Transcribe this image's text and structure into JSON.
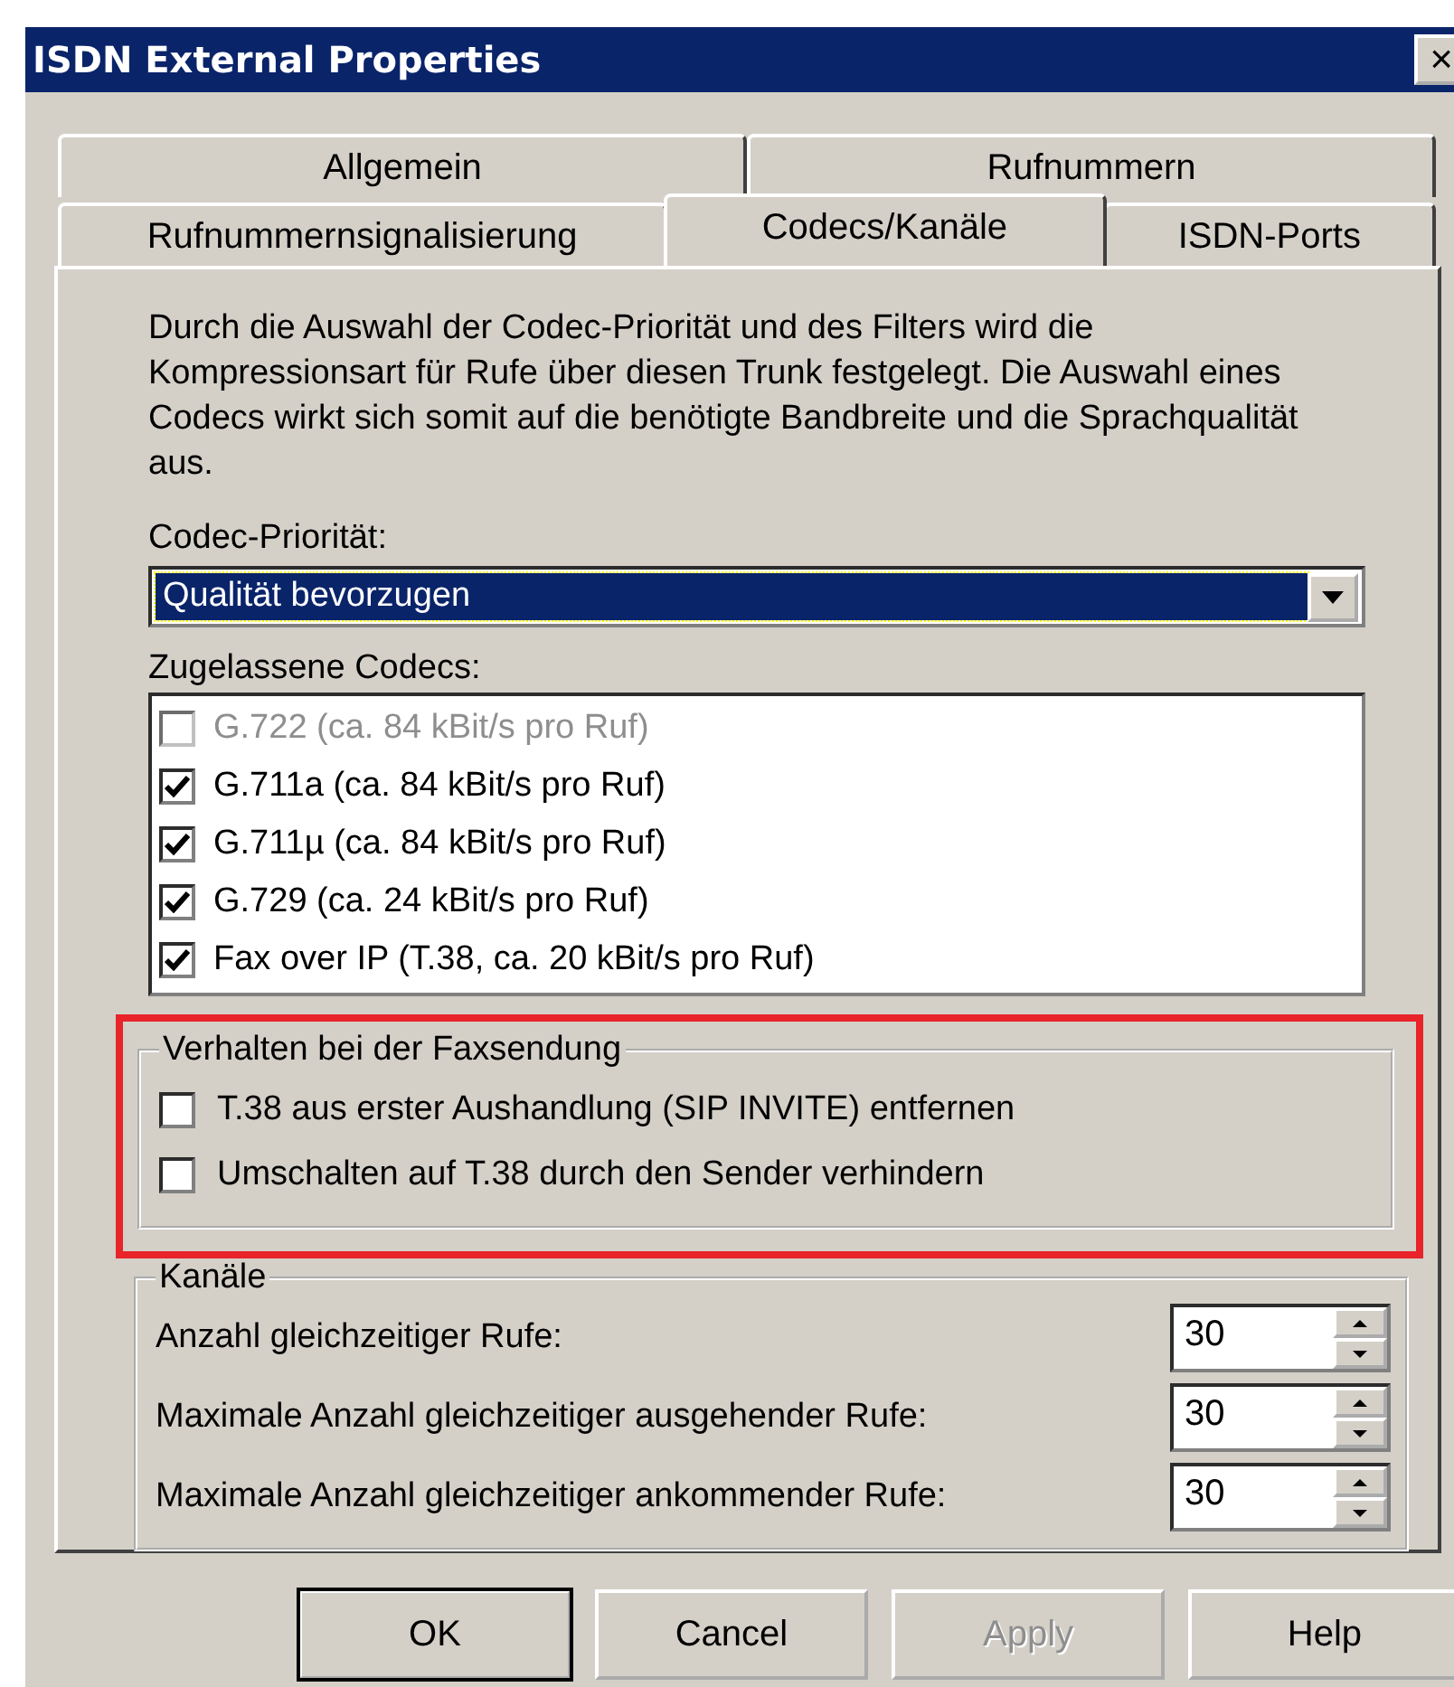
{
  "window": {
    "title": "ISDN External Properties",
    "close": "×"
  },
  "tabs": [
    [
      {
        "label": "Allgemein",
        "selected": false
      },
      {
        "label": "Rufnummern",
        "selected": false
      }
    ],
    [
      {
        "label": "Rufnummernsignalisierung",
        "selected": false
      },
      {
        "label": "Codecs/Kanäle",
        "selected": true
      },
      {
        "label": "ISDN-Ports",
        "selected": false
      }
    ]
  ],
  "description": "Durch die Auswahl der Codec-Priorität und des Filters wird die Kompressionsart für Rufe über diesen Trunk festgelegt. Die Auswahl eines Codecs wirkt sich somit auf die benötigte Bandbreite und die Sprachqualität aus.",
  "codec_priority": {
    "label": "Codec-Priorität:",
    "value": "Qualität bevorzugen"
  },
  "codecs": {
    "label": "Zugelassene Codecs:",
    "items": [
      {
        "label": "G.722 (ca. 84 kBit/s pro Ruf)",
        "checked": false,
        "disabled": true
      },
      {
        "label": "G.711a (ca. 84 kBit/s pro Ruf)",
        "checked": true,
        "disabled": false
      },
      {
        "label": "G.711µ (ca. 84 kBit/s pro Ruf)",
        "checked": true,
        "disabled": false
      },
      {
        "label": "G.729 (ca. 24 kBit/s pro Ruf)",
        "checked": true,
        "disabled": false
      },
      {
        "label": "Fax over IP (T.38, ca. 20 kBit/s pro Ruf)",
        "checked": true,
        "disabled": false
      }
    ]
  },
  "fax": {
    "title": "Verhalten bei der Faxsendung",
    "highlighted": true,
    "options": [
      {
        "label": "T.38 aus erster Aushandlung (SIP INVITE) entfernen",
        "checked": false
      },
      {
        "label": "Umschalten auf T.38 durch den Sender verhindern",
        "checked": false
      }
    ]
  },
  "channels": {
    "title": "Kanäle",
    "rows": [
      {
        "label": "Anzahl gleichzeitiger Rufe:",
        "value": "30"
      },
      {
        "label": "Maximale Anzahl gleichzeitiger ausgehender Rufe:",
        "value": "30"
      },
      {
        "label": "Maximale Anzahl gleichzeitiger ankommender Rufe:",
        "value": "30"
      }
    ]
  },
  "buttons": [
    {
      "label": "OK",
      "default": true,
      "disabled": false
    },
    {
      "label": "Cancel",
      "default": false,
      "disabled": false
    },
    {
      "label": "Apply",
      "default": false,
      "disabled": true
    },
    {
      "label": "Help",
      "default": false,
      "disabled": false
    }
  ]
}
